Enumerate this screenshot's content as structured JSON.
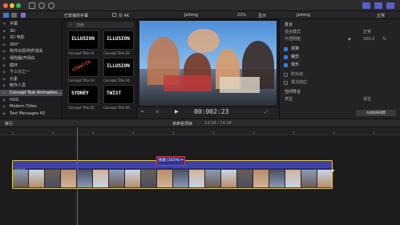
{
  "sidebar": {
    "items": [
      {
        "label": "字幕",
        "expanded": true
      },
      {
        "label": "3D"
      },
      {
        "label": "3D 电影"
      },
      {
        "label": "360°"
      },
      {
        "label": "构件出现/构件消失"
      },
      {
        "label": "保险器/开场白"
      },
      {
        "label": "循环"
      },
      {
        "label": "下三分之一"
      },
      {
        "label": "元素"
      },
      {
        "label": "制作人员"
      },
      {
        "label": "Concept Text Animation..."
      },
      {
        "label": "HUD"
      },
      {
        "label": "Modern Titles"
      },
      {
        "label": "Text Messages 60"
      }
    ]
  },
  "browser": {
    "header": "已安装的字幕",
    "only4k": "仅 4K",
    "search_placeholder": "搜索",
    "items": [
      {
        "caption": "Concept Title 01",
        "art": "ILLUSION"
      },
      {
        "caption": "Concept Title 02",
        "art": "ILLUSION"
      },
      {
        "caption": "Concept Title 03",
        "art": "stealth"
      },
      {
        "caption": "Concept Title 04",
        "art": "ILLUSION"
      },
      {
        "caption": "Concept Title 05",
        "art": "SYDNEY"
      },
      {
        "caption": "Concept Title 06",
        "art": "TWIST"
      }
    ]
  },
  "viewer": {
    "project_name": "joining",
    "zoom": "23%",
    "display_label": "显示",
    "timecode": "00:002:23",
    "timecode_display": "2:23"
  },
  "inspector": {
    "clip_name": "joining",
    "duration": "正常",
    "section": "复合",
    "blend_label": "混合模式",
    "blend_value": "正常",
    "opacity_label": "不透明度",
    "opacity_value": "100.0",
    "opacity_unit": "%",
    "transform": "变换",
    "crop": "裁剪",
    "distort": "变形",
    "stabilize": "防抖动",
    "rolling": "果冻效应",
    "spatial": "空间符合",
    "type_label": "类型",
    "type_value": "适合",
    "save_button": "存储效果预置"
  },
  "timeline": {
    "index_label": "索引",
    "project_label": "未命名项目",
    "duration": "14:18 / 14:18",
    "clip_label": "joining",
    "speed_label": "快速 (321%)",
    "speed_arrow": "▾",
    "clip_end": "▾",
    "ruler_times": [
      "00:00:00:00",
      "00:00:05:00",
      "00:00:10:00",
      "00:00:15:00",
      "00:00:20:00",
      "00:00:25:00",
      "00:00:30:00",
      "00:00:35:00",
      "00:00:40:00",
      "00:00:45:00"
    ]
  },
  "colors": {
    "accent": "#3b7bd6",
    "clip_border": "#e6c84a",
    "speed_bar": "#3d41a8",
    "playhead": "#e23b3b"
  }
}
